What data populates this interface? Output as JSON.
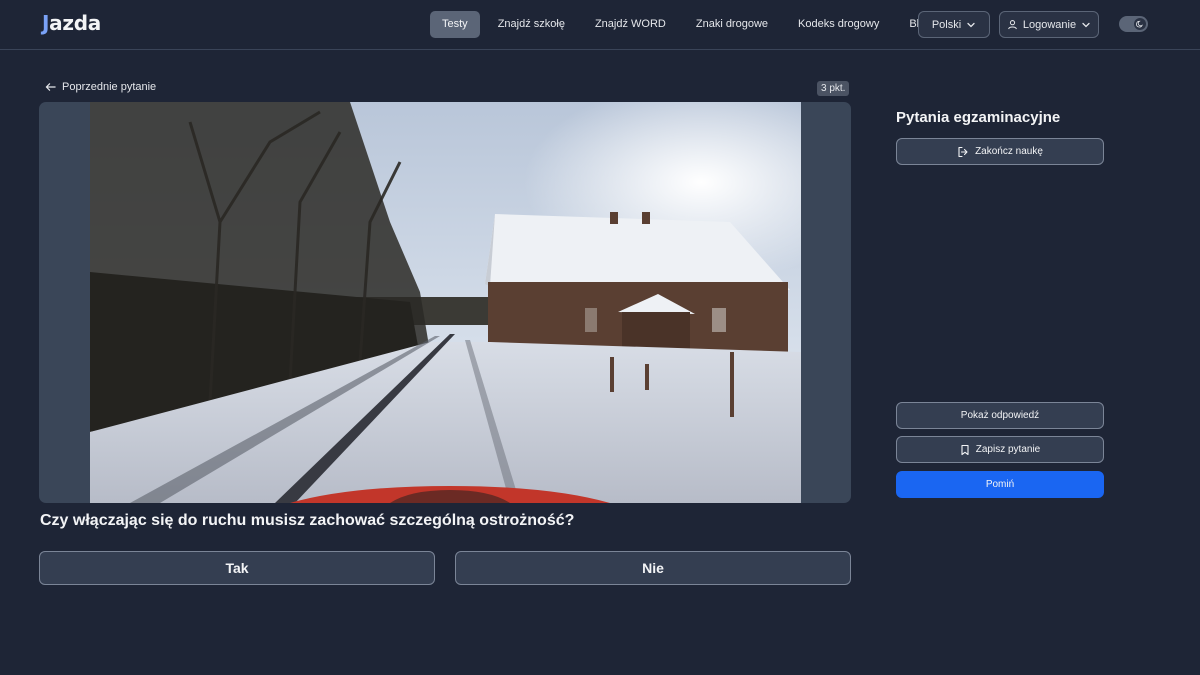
{
  "header": {
    "logo_j": "J",
    "logo_rest": "azda",
    "nav": [
      {
        "label": "Testy",
        "active": true
      },
      {
        "label": "Znajdź szkołę",
        "active": false
      },
      {
        "label": "Znajdź WORD",
        "active": false
      },
      {
        "label": "Znaki drogowe",
        "active": false
      },
      {
        "label": "Kodeks drogowy",
        "active": false
      },
      {
        "label": "Blog",
        "active": false
      }
    ],
    "language": "Polski",
    "login": "Logowanie"
  },
  "question": {
    "back_label": "Poprzednie pytanie",
    "points": "3 pkt.",
    "text": "Czy włączając się do ruchu musisz zachować szczególną ostrożność?",
    "answers": [
      "Tak",
      "Nie"
    ]
  },
  "sidebar": {
    "title": "Pytania egzaminacyjne",
    "end_label": "Zakończ naukę",
    "show_answer_label": "Pokaż odpowiedź",
    "save_label": "Zapisz pytanie",
    "skip_label": "Pomiń"
  },
  "colors": {
    "background": "#1e2536",
    "accent": "#1a66f2",
    "active_tab": "#5b6577"
  },
  "icons": {
    "back": "arrow-left-icon",
    "language_chevron": "chevron-down-icon",
    "user": "user-icon",
    "theme": "moon-icon",
    "end": "logout-icon",
    "save": "bookmark-icon"
  }
}
